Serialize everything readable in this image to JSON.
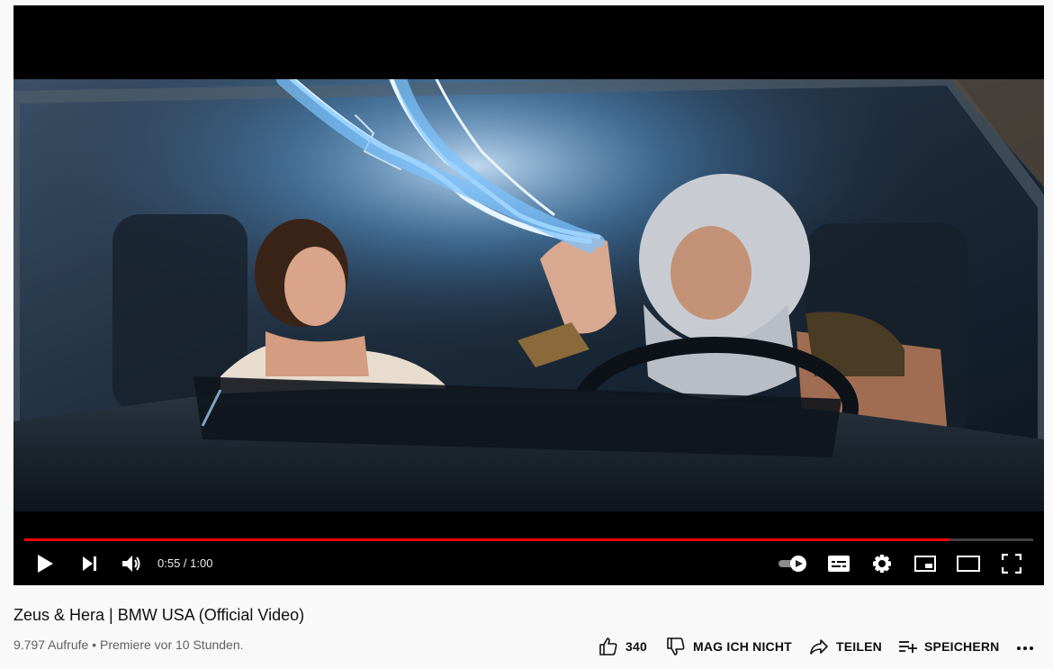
{
  "video": {
    "title": "Zeus & Hera | BMW USA (Official Video)",
    "views": "9.797 Aufrufe",
    "separator": "•",
    "premiere": "Premiere vor 10 Stunden.",
    "progress_fraction": 0.9167
  },
  "player": {
    "time_display": "0:55 / 1:00",
    "controls": [
      "play-icon",
      "next-icon",
      "volume-icon",
      "autoplay-toggle-icon",
      "subtitles-icon",
      "settings-gear-icon",
      "miniplayer-icon",
      "theater-mode-icon",
      "fullscreen-icon"
    ]
  },
  "actions": {
    "like_count": "340",
    "dislike_label": "MAG ICH NICHT",
    "share_label": "TEILEN",
    "save_label": "SPEICHERN"
  },
  "colors": {
    "progress": "#ff0000",
    "page_bg": "#f9f9f9",
    "player_bg": "#000000"
  }
}
